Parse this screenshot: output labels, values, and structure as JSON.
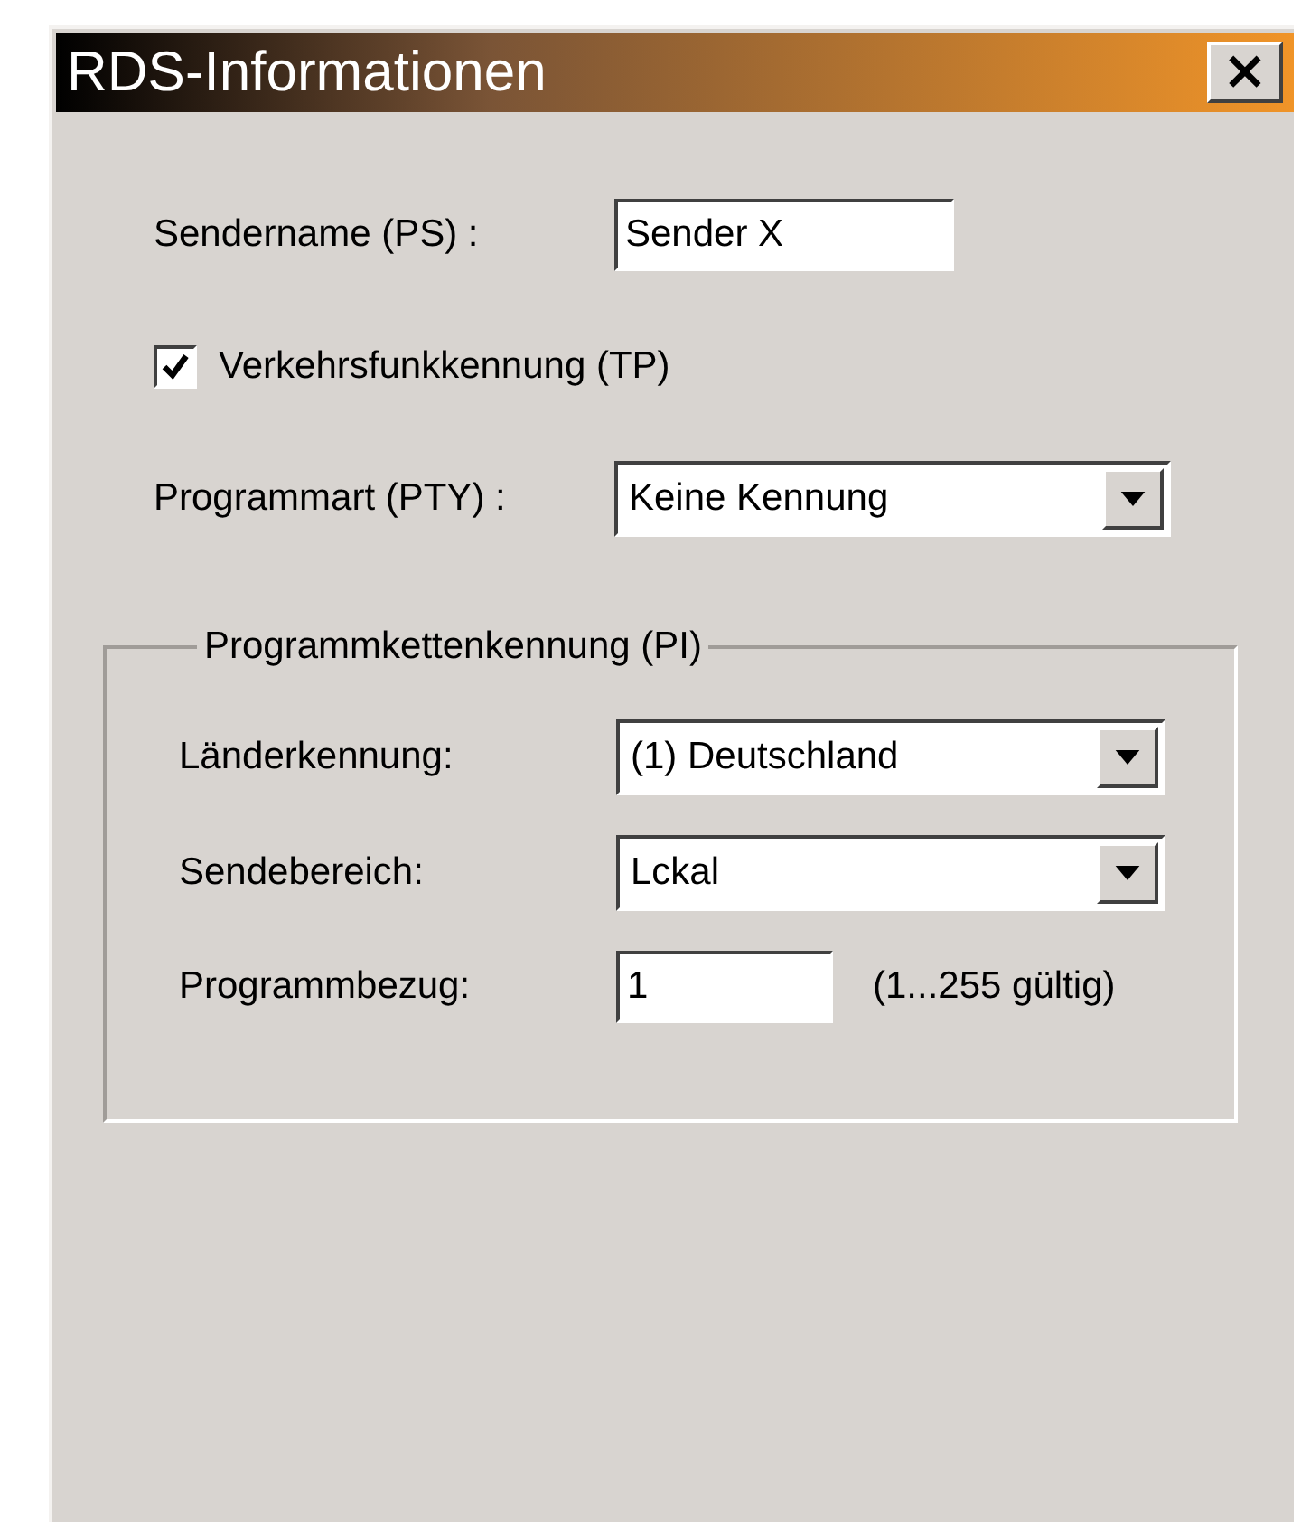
{
  "window": {
    "title": "RDS-Informationen",
    "close": "×"
  },
  "sendername": {
    "label": "Sendername (PS) :",
    "value": "Sender X"
  },
  "traffic": {
    "label": "Verkehrsfunkkennung (TP)",
    "checked": true
  },
  "program_type": {
    "label": "Programmart (PTY) :",
    "value": "Keine Kennung"
  },
  "group": {
    "title": "Programmkettenkennung (PI)",
    "rows": [
      {
        "kind": "select",
        "label": "Länderkennung:",
        "value": "(1) Deutschland"
      },
      {
        "kind": "select",
        "label": "Sendebereich:",
        "value": "Lckal"
      },
      {
        "kind": "input",
        "label": "Programmbezug:",
        "value": "1",
        "hint": "(1...255 gültig)"
      }
    ]
  }
}
